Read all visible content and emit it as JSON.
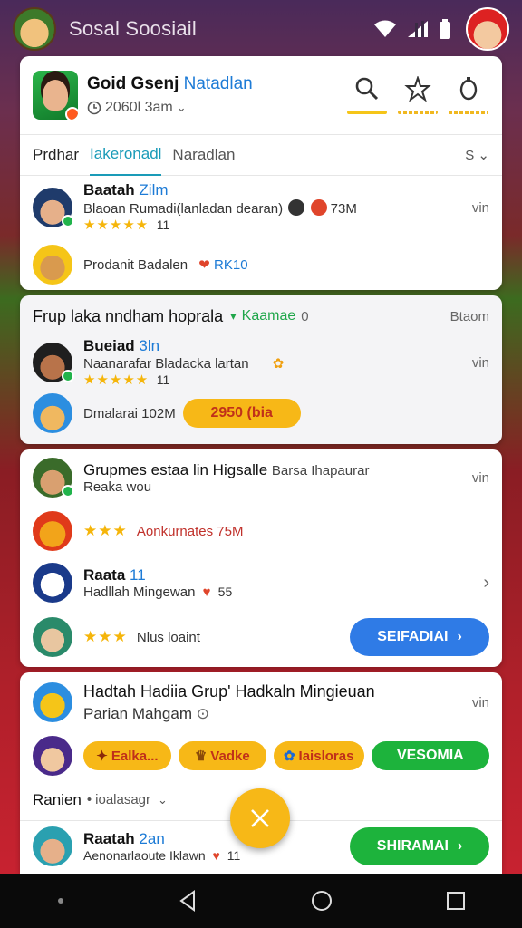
{
  "status_bar": {
    "app_title": "Sosal Soosiail"
  },
  "header": {
    "name": "Goid Gsenj",
    "name_accent": "Natadlan",
    "subtitle": "2060l 3am",
    "actions": [
      {
        "icon": "search-icon"
      },
      {
        "icon": "sparkle-icon"
      },
      {
        "icon": "timer-icon"
      }
    ]
  },
  "tabs": {
    "items": [
      "Prdhar",
      "Iakeronadl",
      "Naradlan"
    ],
    "active_index": 1,
    "more": "S ⌄"
  },
  "feed_top": [
    {
      "title": "Baatah",
      "title_accent": "Zilm",
      "line": "Blaoan Rumadi(lanladan dearan)",
      "stars": "★★★★★",
      "count": "11",
      "badge_text": "73M",
      "side": "vin"
    },
    {
      "line": "Prodanit Badalen",
      "badge_text": "RK10"
    }
  ],
  "group_section": {
    "title": "Frup laka nndham hoprala",
    "filter": "Kaamae",
    "filter_count": "0",
    "right": "Btaom",
    "row1": {
      "title": "Bueiad",
      "title_accent": "3ln",
      "line": "Naanarafar Bladacka lartan",
      "stars": "★★★★★",
      "count": "11",
      "side": "vin"
    },
    "row2": {
      "line": "Dmalarai 102M",
      "pill": "2950 (bia"
    }
  },
  "list_section": {
    "row1": {
      "title": "Grupmes estaa lin Higsalle",
      "title_tail": "Barsa Ihapaurar",
      "line": "Reaka wou",
      "side": "vin"
    },
    "row2": {
      "stars": "★★★",
      "line": "Aonkurnates 75M"
    },
    "row3": {
      "title": "Raata",
      "title_accent": "11",
      "line": "Hadllah Mingewan",
      "count": "55"
    },
    "row4": {
      "stars": "★★★",
      "line": "Nlus loaint",
      "button": "SEIFADIAI"
    }
  },
  "weekly_section": {
    "title": "Hadtah Hadiia Grup' Hadkaln Mingieuan",
    "subtitle": "Parian Mahgam",
    "side": "vin",
    "chips": [
      "Ealka...",
      "Vadke",
      "Iaisloras"
    ],
    "green_button": "VESOMIA",
    "sort_label": "Ranien",
    "sort_value": "ioalasagr",
    "last_row": {
      "title": "Raatah",
      "title_accent": "2an",
      "line": "Aenonarlaoute Iklawn",
      "count": "11",
      "button": "SHIRAMAI"
    }
  },
  "colors": {
    "blue_button": "#2f7be6",
    "green_button": "#1db33c",
    "yellow_pill": "#f7b817",
    "fab": "#f7b817"
  }
}
